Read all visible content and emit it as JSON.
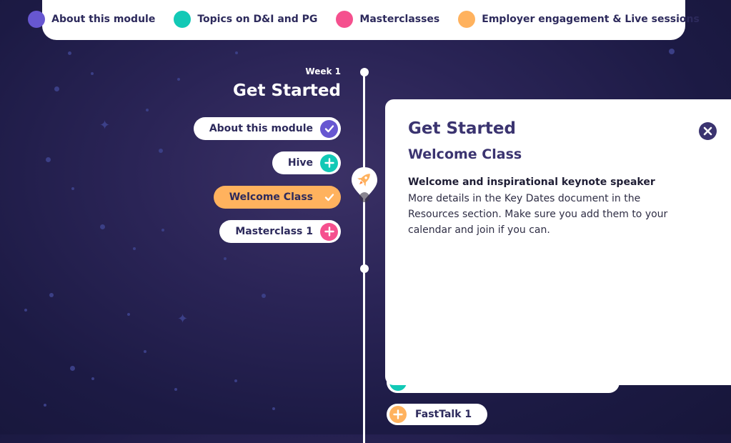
{
  "legend": [
    {
      "label": "About this module",
      "color": "#6757d1"
    },
    {
      "label": "Topics on D&I and PG",
      "color": "#12c9b6"
    },
    {
      "label": "Masterclasses",
      "color": "#f5508e"
    },
    {
      "label": "Employer engagement & Live sessions",
      "color": "#ffb25e"
    }
  ],
  "timeline": {
    "week_label": "Week 1",
    "week_title": "Get Started",
    "items": [
      {
        "label": "About this module",
        "icon": "check-icon",
        "color": "#6757d1",
        "state": "completed"
      },
      {
        "label": "Hive",
        "icon": "plus-icon",
        "color": "#12c9b6",
        "state": "available"
      },
      {
        "label": "Welcome Class",
        "icon": "check-icon",
        "color": "#ffb25e",
        "state": "selected"
      },
      {
        "label": "Masterclass 1",
        "icon": "plus-icon",
        "color": "#f5508e",
        "state": "available"
      }
    ],
    "next_items": [
      {
        "label": "FastTalk 1",
        "icon": "plus-icon",
        "color": "#ffb25e"
      }
    ]
  },
  "panel": {
    "title": "Get Started",
    "subtitle": "Welcome Class",
    "heading": "Welcome and inspirational keynote speaker",
    "description": "More details in the Key Dates document in the Resources section. Make sure you add them to your calendar and join if you can."
  }
}
